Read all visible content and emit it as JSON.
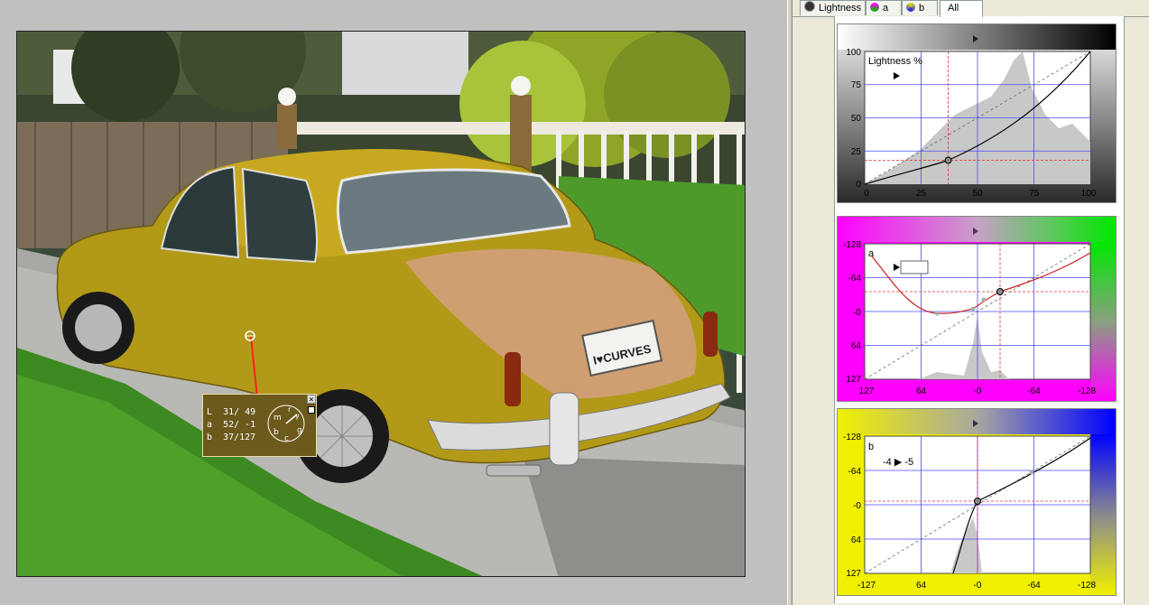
{
  "tabs": [
    {
      "label": "Lightness",
      "icon": "lightness-icon"
    },
    {
      "label": "a",
      "icon": "a-channel-icon"
    },
    {
      "label": "b",
      "icon": "b-channel-icon"
    },
    {
      "label": "All",
      "icon": ""
    }
  ],
  "active_tab": "All",
  "plate_text": "I♥CURVES",
  "readout": {
    "rows": [
      {
        "channel": "L",
        "values": "31/ 49"
      },
      {
        "channel": "a",
        "values": "52/ -1"
      },
      {
        "channel": "b",
        "values": "37/127"
      }
    ],
    "dial_letters": [
      "m",
      "r",
      "y",
      "g",
      "c",
      "b"
    ],
    "close_glyph": "×"
  },
  "panels": {
    "lightness": {
      "label": "Lightness %",
      "y_ticks": [
        "100",
        "75",
        "50",
        "25",
        "0"
      ],
      "x_ticks": [
        "0",
        "25",
        "50",
        "75",
        "100"
      ],
      "control_point": {
        "input": 37,
        "output": 18
      }
    },
    "a": {
      "label": "a",
      "y_ticks": [
        "-128",
        "-64",
        "-0",
        "64",
        "127"
      ],
      "x_ticks": [
        "127",
        "64",
        "-0",
        "-64",
        "-128"
      ]
    },
    "b": {
      "label": "b",
      "arrow_text": "-4 ▶ -5",
      "y_ticks": [
        "-128",
        "-64",
        "-0",
        "64",
        "127"
      ],
      "x_ticks": [
        "-127",
        "64",
        "-0",
        "-64",
        "-128"
      ]
    }
  },
  "colors": {
    "car": "#b29a18",
    "readout_bg": "#6b5a1c",
    "a_left": "#ff00ff",
    "a_right": "#00e800",
    "b_left": "#f0f000",
    "b_right": "#0000ff",
    "curve_red": "#cc2020",
    "grid": "#4a4aff"
  }
}
